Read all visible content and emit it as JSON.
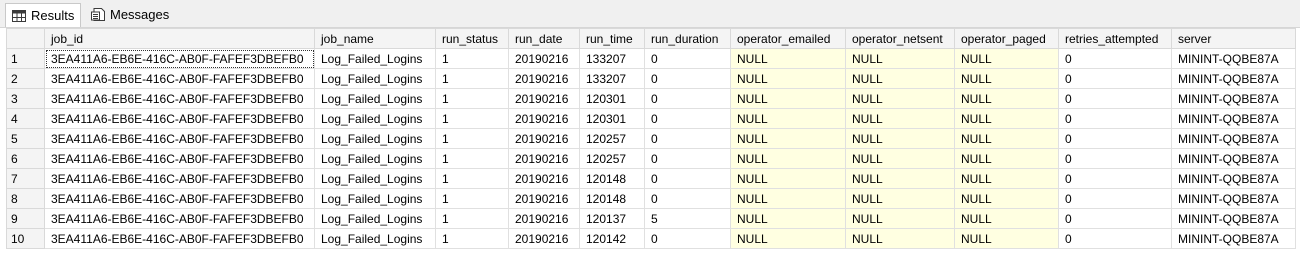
{
  "tabs": {
    "results_label": "Results",
    "messages_label": "Messages"
  },
  "grid": {
    "columns": [
      "job_id",
      "job_name",
      "run_status",
      "run_date",
      "run_time",
      "run_duration",
      "operator_emailed",
      "operator_netsent",
      "operator_paged",
      "retries_attempted",
      "server"
    ],
    "rows": [
      [
        "1",
        "3EA411A6-EB6E-416C-AB0F-FAFEF3DBEFB0",
        "Log_Failed_Logins",
        "1",
        "20190216",
        "133207",
        "0",
        "NULL",
        "NULL",
        "NULL",
        "0",
        "MININT-QQBE87A"
      ],
      [
        "2",
        "3EA411A6-EB6E-416C-AB0F-FAFEF3DBEFB0",
        "Log_Failed_Logins",
        "1",
        "20190216",
        "133207",
        "0",
        "NULL",
        "NULL",
        "NULL",
        "0",
        "MININT-QQBE87A"
      ],
      [
        "3",
        "3EA411A6-EB6E-416C-AB0F-FAFEF3DBEFB0",
        "Log_Failed_Logins",
        "1",
        "20190216",
        "120301",
        "0",
        "NULL",
        "NULL",
        "NULL",
        "0",
        "MININT-QQBE87A"
      ],
      [
        "4",
        "3EA411A6-EB6E-416C-AB0F-FAFEF3DBEFB0",
        "Log_Failed_Logins",
        "1",
        "20190216",
        "120301",
        "0",
        "NULL",
        "NULL",
        "NULL",
        "0",
        "MININT-QQBE87A"
      ],
      [
        "5",
        "3EA411A6-EB6E-416C-AB0F-FAFEF3DBEFB0",
        "Log_Failed_Logins",
        "1",
        "20190216",
        "120257",
        "0",
        "NULL",
        "NULL",
        "NULL",
        "0",
        "MININT-QQBE87A"
      ],
      [
        "6",
        "3EA411A6-EB6E-416C-AB0F-FAFEF3DBEFB0",
        "Log_Failed_Logins",
        "1",
        "20190216",
        "120257",
        "0",
        "NULL",
        "NULL",
        "NULL",
        "0",
        "MININT-QQBE87A"
      ],
      [
        "7",
        "3EA411A6-EB6E-416C-AB0F-FAFEF3DBEFB0",
        "Log_Failed_Logins",
        "1",
        "20190216",
        "120148",
        "0",
        "NULL",
        "NULL",
        "NULL",
        "0",
        "MININT-QQBE87A"
      ],
      [
        "8",
        "3EA411A6-EB6E-416C-AB0F-FAFEF3DBEFB0",
        "Log_Failed_Logins",
        "1",
        "20190216",
        "120148",
        "0",
        "NULL",
        "NULL",
        "NULL",
        "0",
        "MININT-QQBE87A"
      ],
      [
        "9",
        "3EA411A6-EB6E-416C-AB0F-FAFEF3DBEFB0",
        "Log_Failed_Logins",
        "1",
        "20190216",
        "120137",
        "5",
        "NULL",
        "NULL",
        "NULL",
        "0",
        "MININT-QQBE87A"
      ],
      [
        "10",
        "3EA411A6-EB6E-416C-AB0F-FAFEF3DBEFB0",
        "Log_Failed_Logins",
        "1",
        "20190216",
        "120142",
        "0",
        "NULL",
        "NULL",
        "NULL",
        "0",
        "MININT-QQBE87A"
      ]
    ],
    "null_highlight_color": "#ffffe1"
  }
}
